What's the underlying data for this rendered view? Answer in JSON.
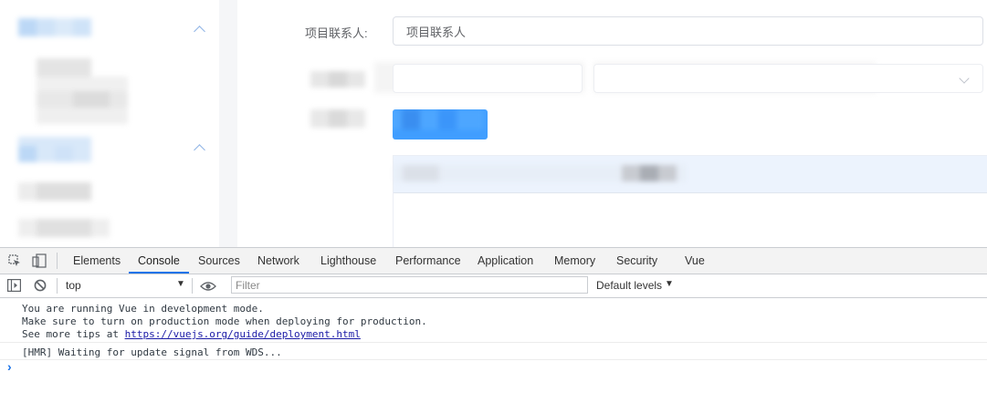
{
  "form": {
    "contact_label": "项目联系人:",
    "contact_value": "项目联系人"
  },
  "devtools": {
    "tabs": [
      "Elements",
      "Console",
      "Sources",
      "Network",
      "Lighthouse",
      "Performance",
      "Application",
      "Memory",
      "Security",
      "Vue"
    ],
    "active_tab": "Console",
    "context": "top",
    "filter_placeholder": "Filter",
    "levels": "Default levels",
    "console": {
      "line1": "You are running Vue in development mode.",
      "line2": "Make sure to turn on production mode when deploying for production.",
      "line3_prefix": "See more tips at ",
      "line3_link": "https://vuejs.org/guide/deployment.html",
      "line4": "[HMR] Waiting for update signal from WDS...",
      "prompt": "›"
    }
  },
  "colors": {
    "accent": "#1a73e8",
    "primary_button": "#409eff",
    "link": "#1a1aa6"
  }
}
